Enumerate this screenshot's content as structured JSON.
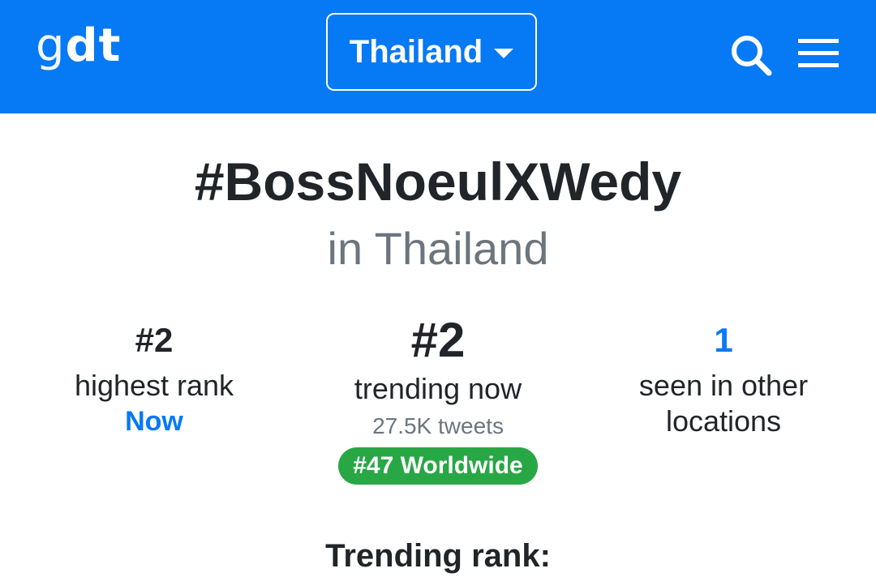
{
  "header": {
    "logo_light": "g",
    "logo_bold": "dt",
    "country_selector": "Thailand",
    "icons": [
      "search-icon",
      "menu-icon",
      "chevron-down-icon"
    ]
  },
  "main": {
    "hashtag": "#BossNoeulXWedy",
    "location": "in Thailand",
    "stats": {
      "highest": {
        "value": "#2",
        "label": "highest rank",
        "sub": "Now"
      },
      "current": {
        "value": "#2",
        "label": "trending now",
        "tweets": "27.5K tweets",
        "worldwide": "#47 Worldwide"
      },
      "other": {
        "value": "1",
        "label_line1": "seen in other",
        "label_line2": "locations"
      }
    },
    "section_title": "Trending rank:"
  },
  "colors": {
    "brand": "#0679f5",
    "badge_green": "#28a745",
    "text_dark": "#212529",
    "text_muted": "#6c757d"
  }
}
